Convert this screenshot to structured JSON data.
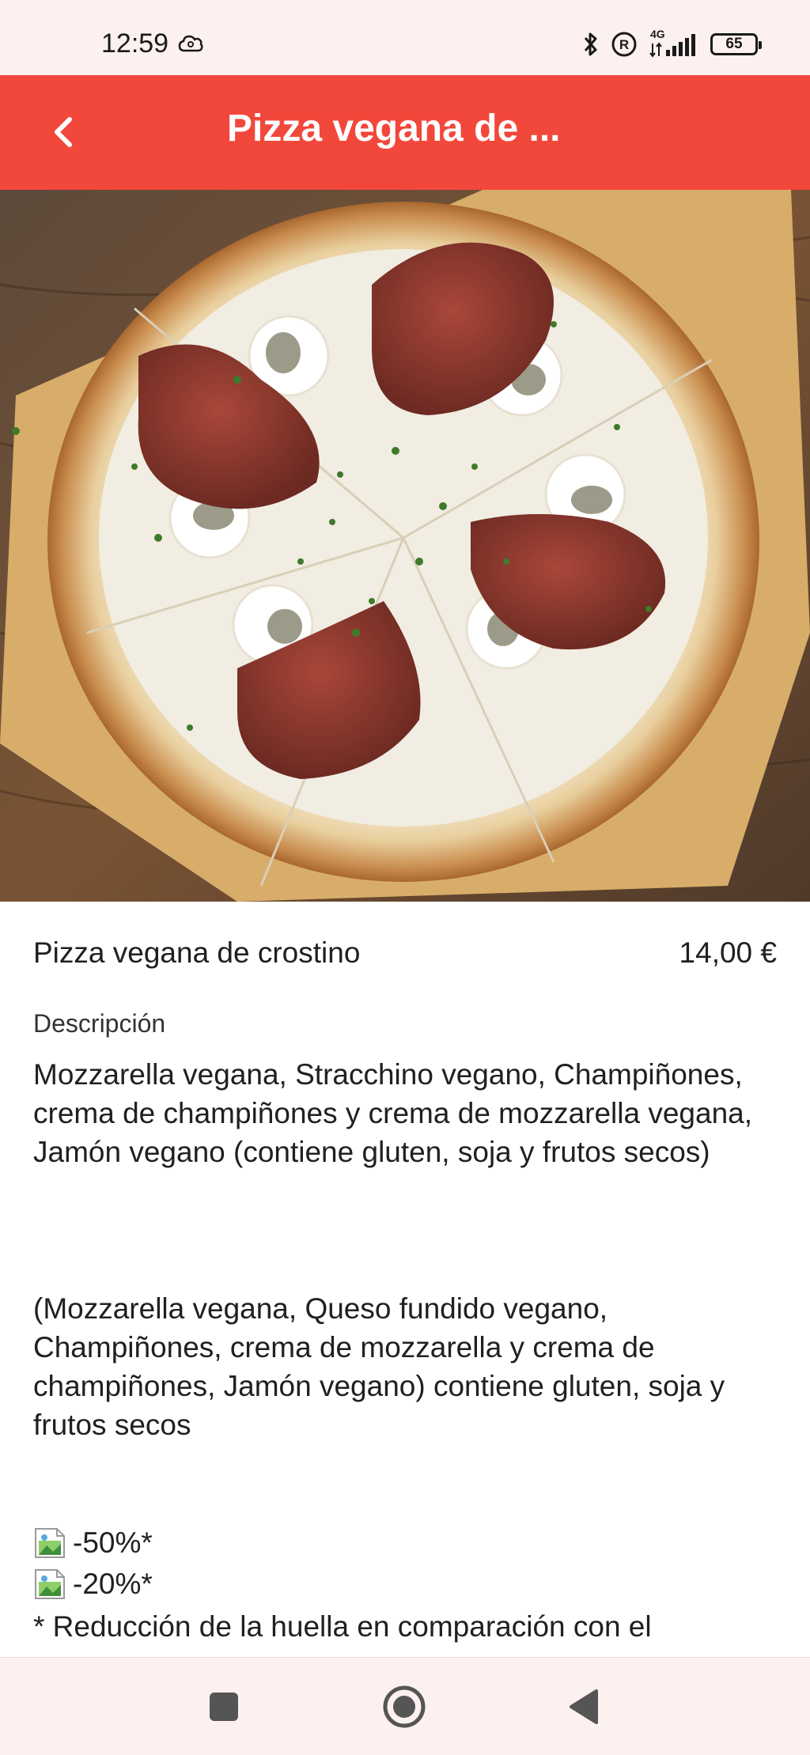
{
  "status_bar": {
    "time": "12:59",
    "network": "4G",
    "battery": "65"
  },
  "app_bar": {
    "title": "Pizza vegana de ..."
  },
  "item": {
    "name": "Pizza vegana de crostino",
    "price": "14,00 €",
    "description_label": "Descripción",
    "description": "Mozzarella vegana, Stracchino vegano, Champiñones, crema de champiñones y crema de mozzarella vegana, Jamón vegano (contiene gluten, soja y frutos secos)",
    "description_alt": "(Mozzarella vegana, Queso fundido vegano, Champiñones, crema de mozzarella y crema de champiñones, Jamón vegano) contiene gluten, soja y frutos secos",
    "badges": [
      "-50%*",
      "-20%*"
    ],
    "footnote": "*  Reducción de la huella en comparación con el"
  },
  "colors": {
    "app_bar": "#f2473b",
    "status_bar": "#fdf1ef",
    "text": "#202020"
  },
  "icons": {
    "back": "chevron-left-icon",
    "recents": "square-icon",
    "home": "circle-home-icon",
    "nav_back": "triangle-back-icon"
  }
}
